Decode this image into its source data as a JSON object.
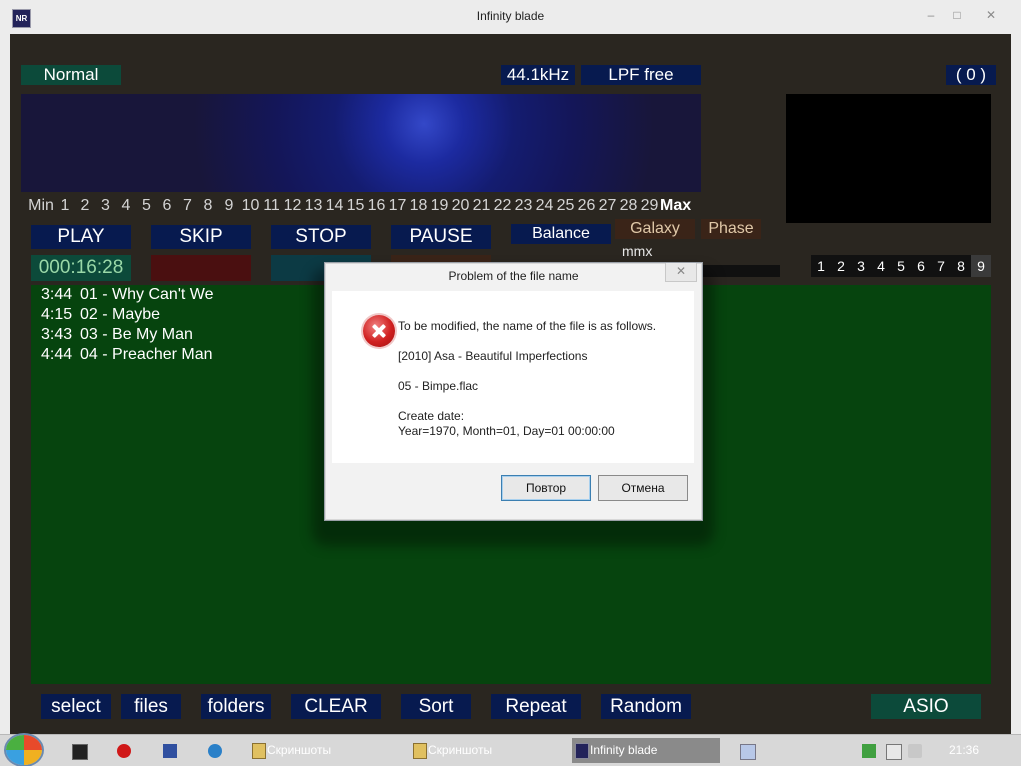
{
  "window": {
    "title": "Infinity blade",
    "icon_text": "NR",
    "controls": [
      "–",
      "□",
      "✕"
    ]
  },
  "header": {
    "mode": "Normal",
    "sample_rate": "44.1kHz",
    "filter": "LPF free",
    "count": "( 0 )"
  },
  "eq_scale": [
    "Min",
    "1",
    "2",
    "3",
    "4",
    "5",
    "6",
    "7",
    "8",
    "9",
    "10",
    "11",
    "12",
    "13",
    "14",
    "15",
    "16",
    "17",
    "18",
    "19",
    "20",
    "21",
    "22",
    "23",
    "24",
    "25",
    "26",
    "27",
    "28",
    "29",
    "Max"
  ],
  "controls": {
    "play": "PLAY",
    "skip": "SKIP",
    "stop": "STOP",
    "pause": "PAUSE",
    "balance": "Balance",
    "galaxy": "Galaxy",
    "phase": "Phase",
    "mmx": "mmx ++"
  },
  "time": "000:16:28",
  "presets": [
    "1",
    "2",
    "3",
    "4",
    "5",
    "6",
    "7",
    "8",
    "9"
  ],
  "active_preset": "9",
  "playlist": [
    {
      "duration": "3:44",
      "title": "01 - Why Can't We"
    },
    {
      "duration": "4:15",
      "title": "02 - Maybe"
    },
    {
      "duration": "3:43",
      "title": "03 - Be My Man"
    },
    {
      "duration": "4:44",
      "title": "04 - Preacher Man"
    }
  ],
  "bottom_buttons": {
    "select": "select",
    "files": "files",
    "folders": "folders",
    "clear": "CLEAR",
    "sort": "Sort",
    "repeat": "Repeat",
    "random": "Random",
    "asio": "ASIO"
  },
  "dialog": {
    "title": "Problem of the file name",
    "close": "✕",
    "line1": "To be modified, the name of the file is as follows.",
    "line2": "[2010] Asa - Beautiful Imperfections",
    "line3": "05 - Bimpe.flac",
    "line4": "Create date:",
    "line5": "Year=1970, Month=01, Day=01  00:00:00",
    "retry": "Повтор",
    "cancel": "Отмена"
  },
  "taskbar": {
    "task1": "Скриншоты",
    "task2": "Скриншоты",
    "task3": "Infinity blade",
    "clock": "21:36"
  }
}
